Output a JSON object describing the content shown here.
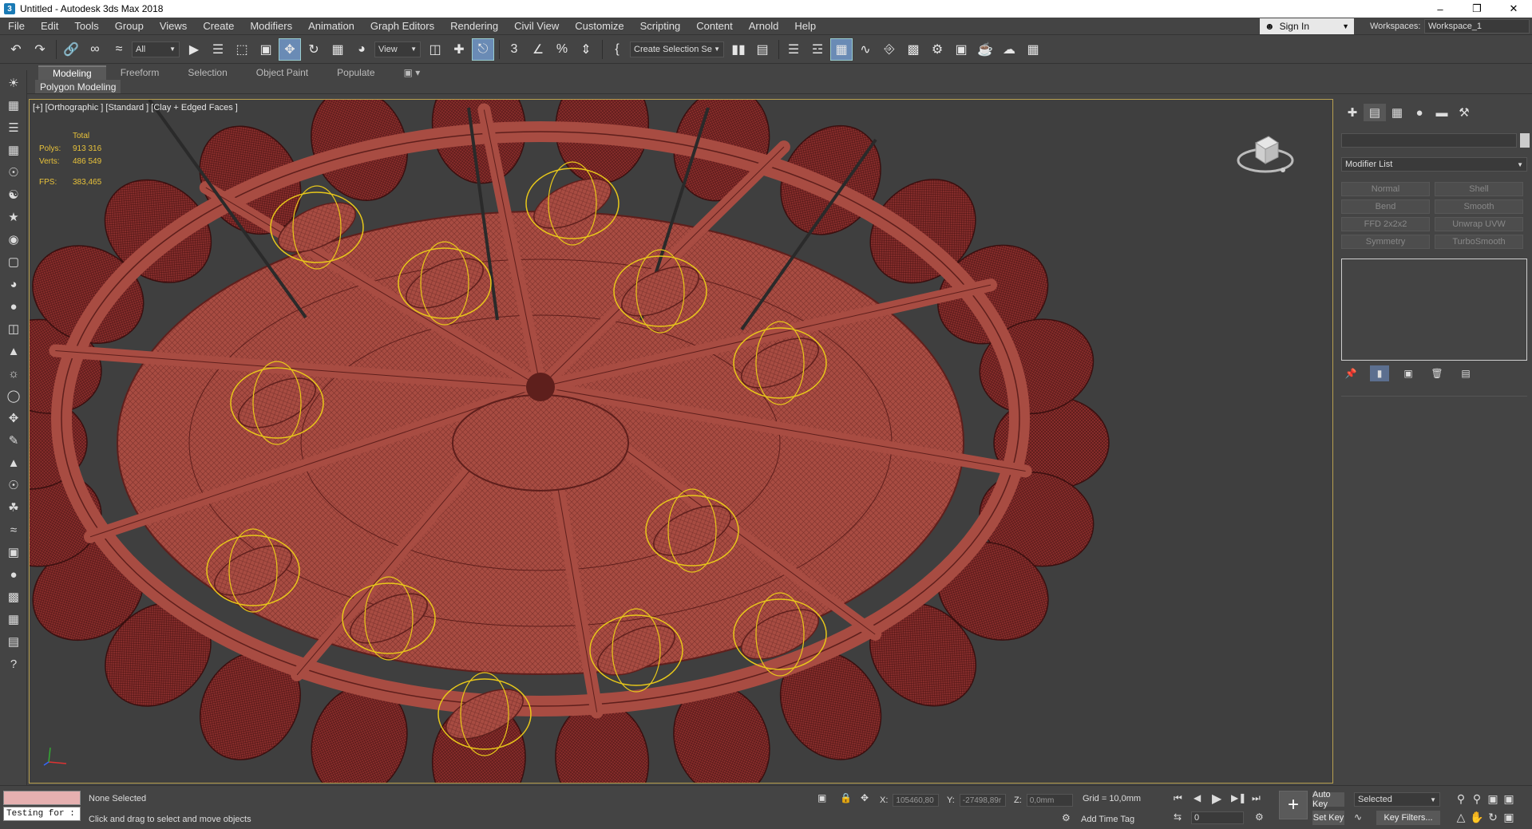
{
  "window": {
    "title": "Untitled - Autodesk 3ds Max 2018",
    "app_icon": "3ds-max-icon",
    "controls": [
      "–",
      "❐",
      "✕"
    ]
  },
  "menu": {
    "items": [
      "File",
      "Edit",
      "Tools",
      "Group",
      "Views",
      "Create",
      "Modifiers",
      "Animation",
      "Graph Editors",
      "Rendering",
      "Civil View",
      "Customize",
      "Scripting",
      "Content",
      "Arnold",
      "Help"
    ],
    "sign_in": "Sign In",
    "workspaces_label": "Workspaces:",
    "workspace_value": "Workspace_1"
  },
  "main_toolbar": {
    "selection_filter": "All",
    "ref_coord": "View",
    "named_selection": "Create Selection Se"
  },
  "ribbon": {
    "tabs": [
      "Modeling",
      "Freeform",
      "Selection",
      "Object Paint",
      "Populate"
    ],
    "active_tab": "Modeling",
    "sub_label": "Polygon Modeling"
  },
  "viewport": {
    "label": "[+] [Orthographic ] [Standard ] [Clay + Edged Faces ]",
    "stats": {
      "total_label": "Total",
      "polys_label": "Polys:",
      "polys_value": "913 316",
      "verts_label": "Verts:",
      "verts_value": "486 549",
      "fps_label": "FPS:",
      "fps_value": "383,465"
    },
    "colors": {
      "model": "#a84c42",
      "model_dark": "#5e1f1c",
      "lights": "#e8c81a",
      "background": "#3f3f3f",
      "border": "#b8a050"
    }
  },
  "command_panel": {
    "modifier_list": "Modifier List",
    "modifier_buttons": [
      "Normal",
      "Shell",
      "Bend",
      "Smooth",
      "FFD 2x2x2",
      "Unwrap UVW",
      "Symmetry",
      "TurboSmooth"
    ]
  },
  "status": {
    "maxscript_text": "Testing for :",
    "selection": "None Selected",
    "prompt": "Click and drag to select and move objects",
    "x_label": "X:",
    "x_value": "105460,80",
    "y_label": "Y:",
    "y_value": "-27498,89r",
    "z_label": "Z:",
    "z_value": "0,0mm",
    "grid": "Grid = 10,0mm",
    "add_time_tag": "Add Time Tag",
    "frame": "0",
    "auto_key": "Auto Key",
    "set_key": "Set Key",
    "selected_dropdown": "Selected",
    "key_filters": "Key Filters..."
  }
}
